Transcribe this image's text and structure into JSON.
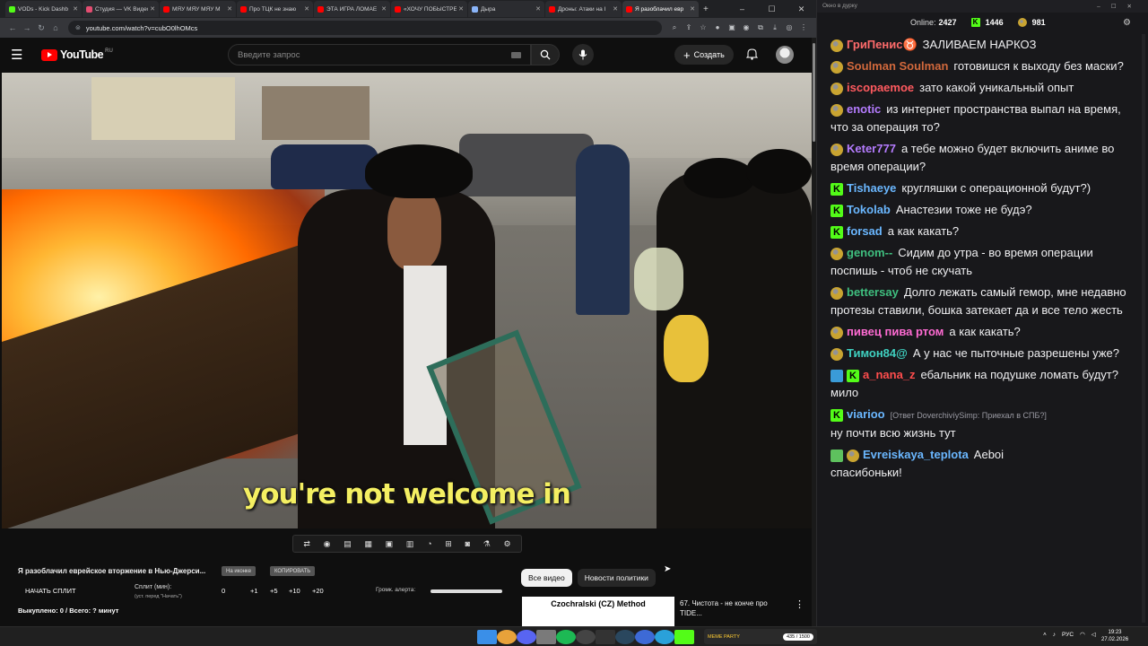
{
  "browser": {
    "tabs": [
      {
        "label": "VODs - Kick Dashb",
        "color": "#53fc18"
      },
      {
        "label": "Студия — VK Видео",
        "color": "#e44d71"
      },
      {
        "label": "МЯУ МЯУ МЯУ М",
        "color": "#ff0000"
      },
      {
        "label": "Про ТЦК не знаю",
        "color": "#ff0000"
      },
      {
        "label": "ЭТА ИГРА ЛОМАЕ",
        "color": "#ff0000"
      },
      {
        "label": "«ХОЧУ ПОБЫСТРЕ",
        "color": "#ff0000"
      },
      {
        "label": "Дыра",
        "color": "#8ab4f8"
      },
      {
        "label": "Дроны: Атаки на I",
        "color": "#ff0000"
      },
      {
        "label": "Я разоблачил евр",
        "color": "#ff0000",
        "active": true
      }
    ],
    "url": "youtube.com/watch?v=cubO0lhOMcs"
  },
  "youtube": {
    "logo_text": "YouTube",
    "country": "RU",
    "search_placeholder": "Введите запрос",
    "create_label": "Создать",
    "subtitle": "you're not welcome in",
    "chips": [
      "Все видео",
      "Новости политики"
    ],
    "recommendation": {
      "thumb_title": "Czochralski (CZ) Method",
      "title": "67. Чистота - не конче про TIDE..."
    }
  },
  "extension": {
    "title": "Я разоблачил еврейское вторжение в Нью-Джерси...",
    "chip1": "На иконке",
    "chip2": "КОПИРОВАТЬ",
    "start_split": "НАЧАТЬ СПЛИТ",
    "split_min_label": "Сплит (мин):",
    "split_min_hint": "(уст. перед \"Начать\")",
    "split_values": [
      "0",
      "+1",
      "+5",
      "+10",
      "+20"
    ],
    "alert_volume": "Громк. алерта:",
    "bought": "Выкуплено: 0 / Всего: ? минут"
  },
  "chat": {
    "window_title": "Окно в дурку",
    "online_label": "Online:",
    "online_count": "2427",
    "kick_count": "1446",
    "indicator_count": "981",
    "messages": [
      {
        "user": "ГриПенис♉",
        "color": "#ff6b6b",
        "badges": [
          "ind"
        ],
        "text": "ЗАЛИВАЕМ НАРКОЗ"
      },
      {
        "user": "Soulman Soulman",
        "color": "#d2693c",
        "badges": [
          "ind"
        ],
        "text": "готовишся к выходу без маски?"
      },
      {
        "user": "iscopaemoe",
        "color": "#ff5a5f",
        "badges": [
          "ind"
        ],
        "text": "зато какой уникальный опыт"
      },
      {
        "user": "enotic",
        "color": "#b57cff",
        "badges": [
          "ind"
        ],
        "text": "из интернет пространства выпал на время, что за операция то?"
      },
      {
        "user": "Keter777",
        "color": "#b57cff",
        "badges": [
          "ind"
        ],
        "text": "а тебе можно будет включить аниме во время операции?"
      },
      {
        "user": "Tishaeye",
        "color": "#6ab7ff",
        "badges": [
          "kick"
        ],
        "text": "кругляшки с операционной будут?)"
      },
      {
        "user": "Tokolab",
        "color": "#6ab7ff",
        "badges": [
          "kick"
        ],
        "text": "Анастезии тоже не будэ?"
      },
      {
        "user": "forsad",
        "color": "#6ab7ff",
        "badges": [
          "kick"
        ],
        "text": "а как какать?"
      },
      {
        "user": "genom--",
        "color": "#3fbf7f",
        "badges": [
          "ind"
        ],
        "text": "Сидим до утра - во время операции поспишь - чтоб не скучать"
      },
      {
        "user": "bettersay",
        "color": "#3fbf7f",
        "badges": [
          "ind"
        ],
        "text": "Долго лежать самый гемор, мне недавно протезы ставили, бошка затекает да и все тело жесть"
      },
      {
        "user": "пивец пива ртом",
        "color": "#ff6bd3",
        "badges": [
          "ind"
        ],
        "text": "а как какать?"
      },
      {
        "user": "Тимон84@",
        "color": "#3fd0c0",
        "badges": [
          "ind"
        ],
        "text": "А у нас че пыточные разрешены уже?"
      },
      {
        "user": "a_nana_z",
        "color": "#ff4d4d",
        "badges": [
          "sword",
          "kick"
        ],
        "text": "ебальник на подушке ломать будут? мило"
      },
      {
        "user": "viarioo",
        "color": "#6ab7ff",
        "badges": [
          "kick"
        ],
        "reply": "[Ответ DoverchivíySimp: Приехал в СПБ?]",
        "text": "ну почти всю жизнь тут"
      },
      {
        "user": "Evreiskaya_teplota",
        "color": "#6ab7ff",
        "badges": [
          "check",
          "ind"
        ],
        "text": "Aeboi",
        "text2": "спасибоньки!"
      }
    ]
  },
  "taskbar": {
    "meme_label": "MEME PARTY",
    "meme_count": "435 / 1500",
    "lang": "РУС",
    "time": "19:23",
    "date": "27.02.2026"
  }
}
